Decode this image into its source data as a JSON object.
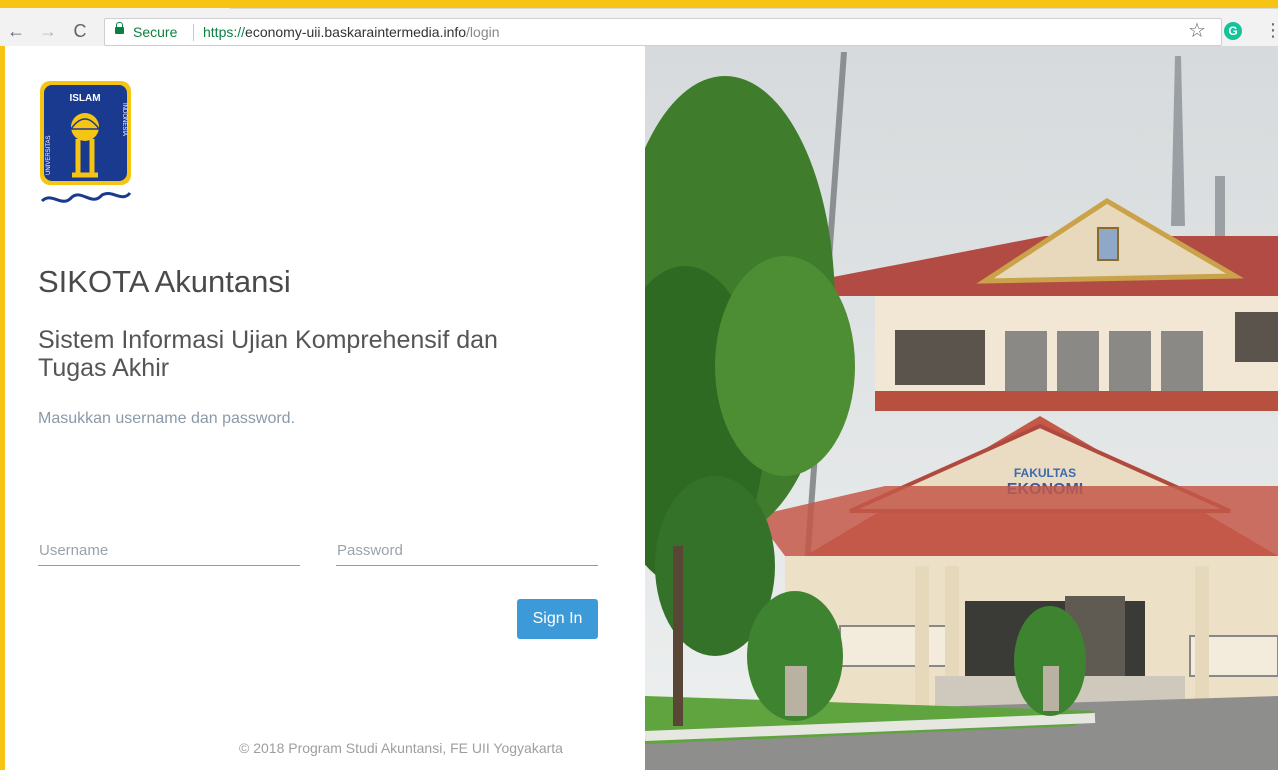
{
  "browser": {
    "back_icon": "←",
    "forward_icon": "→",
    "reload_icon": "C",
    "secure_label": "Secure",
    "url_scheme": "https://",
    "url_host": "economy-uii.baskaraintermedia.info",
    "url_path": "/login",
    "star_icon": "☆",
    "extension_letter": "G",
    "menu_icon": "⋮"
  },
  "login": {
    "title": "SIKOTA Akuntansi",
    "subtitle": "Sistem Informasi Ujian Komprehensif dan Tugas Akhir",
    "instruction": "Masukkan username dan password.",
    "username_placeholder": "Username",
    "password_placeholder": "Password",
    "signin_label": "Sign In",
    "footer": "© 2018 Program Studi Akuntansi, FE UII Yogyakarta"
  },
  "logo": {
    "top_text": "ISLAM",
    "left_text": "UNIVERSITAS",
    "right_text": "INDONESIA"
  },
  "photo": {
    "sign_line1": "FAKULTAS",
    "sign_line2": "EKONOMI"
  },
  "colors": {
    "frame": "#f6c513",
    "button": "#3c9ad9",
    "secure_green": "#0b8043"
  }
}
